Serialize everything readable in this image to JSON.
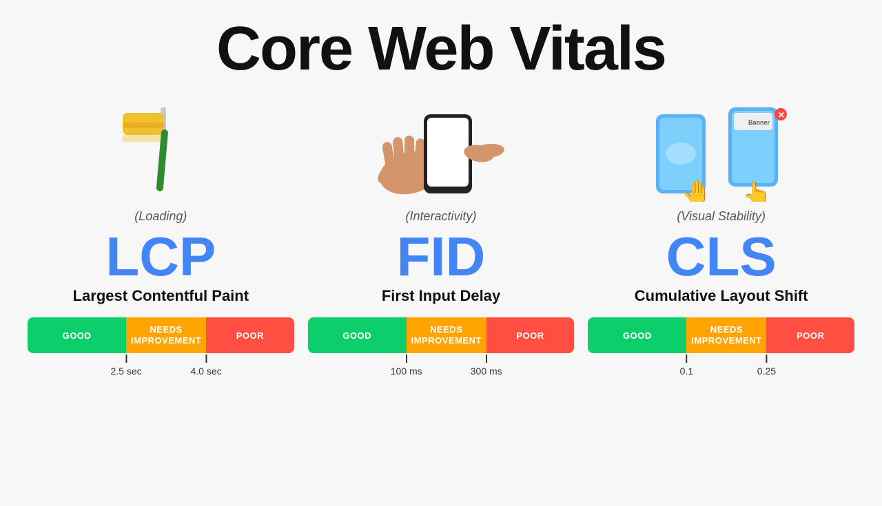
{
  "title": "Core Web Vitals",
  "metrics": [
    {
      "id": "lcp",
      "category": "(Loading)",
      "acronym": "LCP",
      "name": "Largest Contentful Paint",
      "bar": {
        "good_label": "GOOD",
        "needs_label": "NEEDS\nIMPROVEMENT",
        "poor_label": "POOR",
        "good_pct": 37,
        "needs_pct": 30
      },
      "ticks": [
        {
          "value": "2.5 sec",
          "pct": 37
        },
        {
          "value": "4.0 sec",
          "pct": 67
        }
      ]
    },
    {
      "id": "fid",
      "category": "(Interactivity)",
      "acronym": "FID",
      "name": "First Input Delay",
      "bar": {
        "good_label": "GOOD",
        "needs_label": "NEEDS\nIMPROVEMENT",
        "poor_label": "POOR",
        "good_pct": 37,
        "needs_pct": 30
      },
      "ticks": [
        {
          "value": "100 ms",
          "pct": 37
        },
        {
          "value": "300 ms",
          "pct": 67
        }
      ]
    },
    {
      "id": "cls",
      "category": "(Visual Stability)",
      "acronym": "CLS",
      "name": "Cumulative Layout Shift",
      "bar": {
        "good_label": "GOOD",
        "needs_label": "NEEDS\nIMPROVEMENT",
        "poor_label": "POOR",
        "good_pct": 37,
        "needs_pct": 30
      },
      "ticks": [
        {
          "value": "0.1",
          "pct": 37
        },
        {
          "value": "0.25",
          "pct": 67
        }
      ]
    }
  ]
}
